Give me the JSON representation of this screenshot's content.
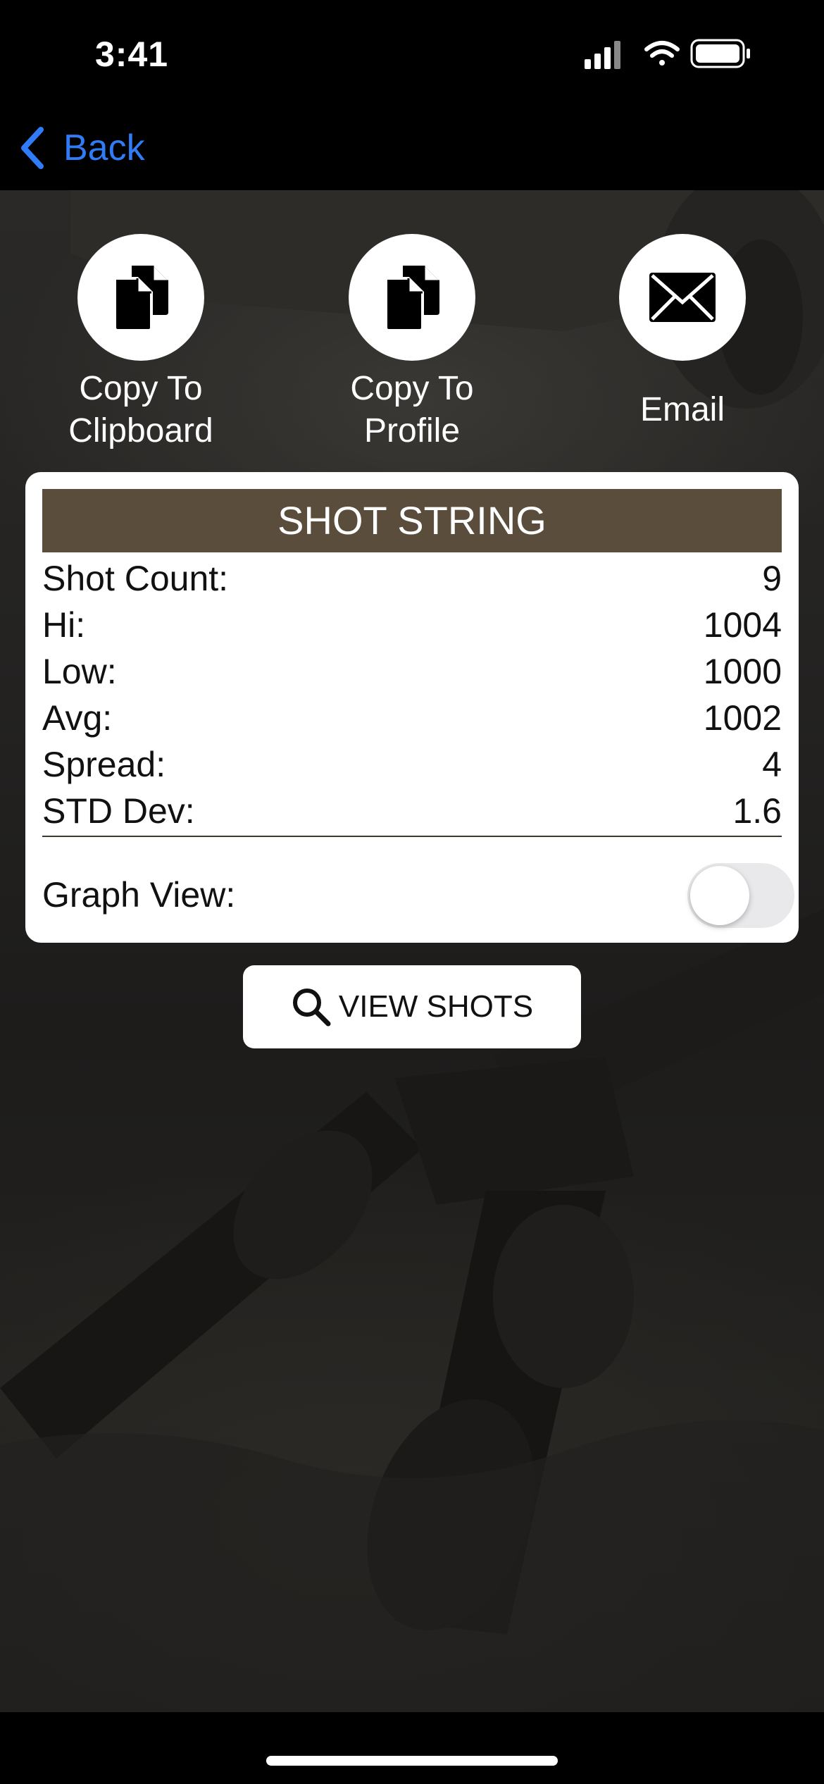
{
  "status_bar": {
    "time": "3:41",
    "icons": [
      "cellular-signal-icon",
      "wifi-icon",
      "battery-icon"
    ]
  },
  "nav": {
    "back_label": "Back",
    "accent_color": "#2f7cf6"
  },
  "actions": [
    {
      "label": "Copy To\nClipboard",
      "icon": "copy-documents-icon"
    },
    {
      "label": "Copy To\nProfile",
      "icon": "copy-documents-icon"
    },
    {
      "label": "Email",
      "icon": "envelope-icon"
    }
  ],
  "shot_string": {
    "title": "SHOT STRING",
    "header_color": "#5a4d3b",
    "stats": [
      {
        "label": "Shot Count:",
        "value": "9"
      },
      {
        "label": "Hi:",
        "value": "1004"
      },
      {
        "label": "Low:",
        "value": "1000"
      },
      {
        "label": "Avg:",
        "value": "1002"
      },
      {
        "label": "Spread:",
        "value": "4"
      },
      {
        "label": "STD Dev:",
        "value": "1.6"
      }
    ],
    "graph_view_label": "Graph View:",
    "graph_view_enabled": false
  },
  "view_shots": {
    "label": "VIEW SHOTS",
    "icon": "magnifying-glass-icon"
  }
}
